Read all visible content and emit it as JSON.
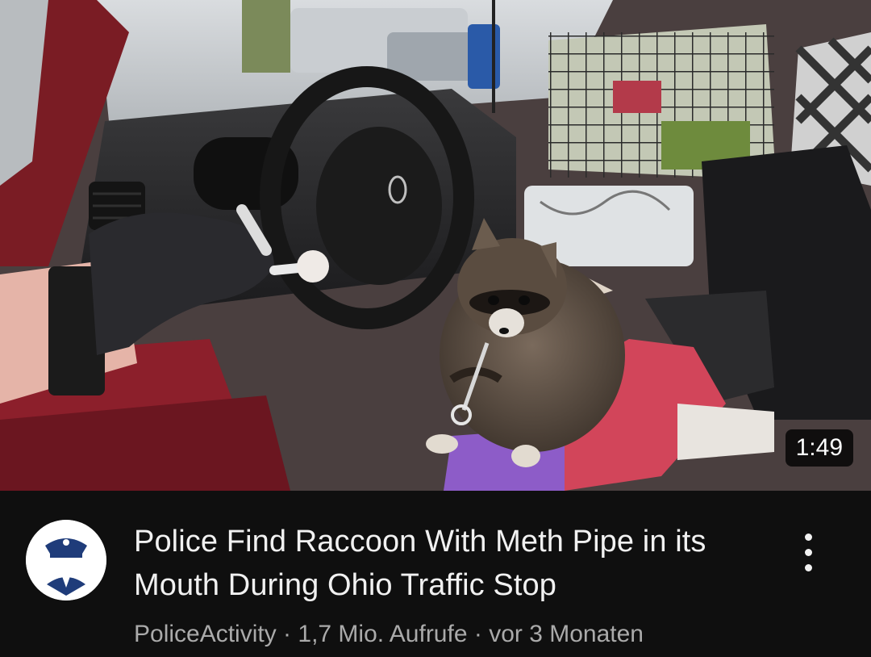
{
  "video": {
    "duration": "1:49",
    "title": "Police Find Raccoon With Meth Pipe in its Mouth During Ohio Traffic Stop",
    "channel": "PoliceActivity",
    "separator": " · ",
    "views": "1,7 Mio. Aufrufe",
    "age": "vor 3 Monaten",
    "thumbnail_subject": "raccoon-in-car-icon",
    "avatar_icon": "police-officer-icon",
    "more_icon": "more-vert-icon"
  },
  "colors": {
    "background": "#0f0f0f",
    "title": "#f1f1f1",
    "meta": "#aaaaaa",
    "badge_bg": "#000000",
    "avatar_blue": "#1f3c7a"
  }
}
